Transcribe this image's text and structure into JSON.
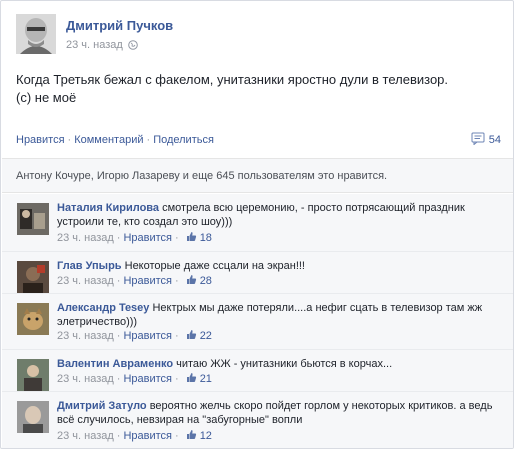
{
  "post": {
    "author": "Дмитрий Пучков",
    "time": "23 ч. назад",
    "text_lines": [
      "Когда Третьяк бежал с факелом, унитазники яростно дули в телевизор.",
      "(с) не моё"
    ],
    "actions": {
      "like": "Нравится",
      "comment": "Комментарий",
      "share": "Поделиться"
    },
    "comment_count": "54",
    "likes_summary": "Антону Кочуре, Игорю Лазареву и еще 645 пользователям это нравится."
  },
  "comments": [
    {
      "name": "Наталия Кирилова",
      "text": "смотрела всю церемонию, - просто потрясающий праздник устроили те, кто создал это шоу)))",
      "time": "23 ч. назад",
      "like_label": "Нравится",
      "likes": "18",
      "avatar_color": "#6d6a64"
    },
    {
      "name": "Глав Упырь",
      "text": "Некоторые даже ссцали на экран!!!",
      "time": "23 ч. назад",
      "like_label": "Нравится",
      "likes": "28",
      "avatar_color": "#5a4a3f"
    },
    {
      "name": "Александр Tesey",
      "text": "Нектрых мы даже потеряли....а нефиг сцать в телевизор там жж элетричество)))",
      "time": "23 ч. назад",
      "like_label": "Нравится",
      "likes": "22",
      "avatar_color": "#8a7a55"
    },
    {
      "name": "Валентин Авраменко",
      "text": "читаю ЖЖ - унитазники бьются в корчах...",
      "time": "23 ч. назад",
      "like_label": "Нравится",
      "likes": "21",
      "avatar_color": "#6f7d6b"
    },
    {
      "name": "Дмитрий Затуло",
      "text": "вероятно желчь скоро пойдет горлом у некоторых критиков. а ведь всё случилось, невзирая на \"забугорные\" вопли",
      "time": "23 ч. назад",
      "like_label": "Нравится",
      "likes": "12",
      "avatar_color": "#9a9a9a"
    }
  ]
}
